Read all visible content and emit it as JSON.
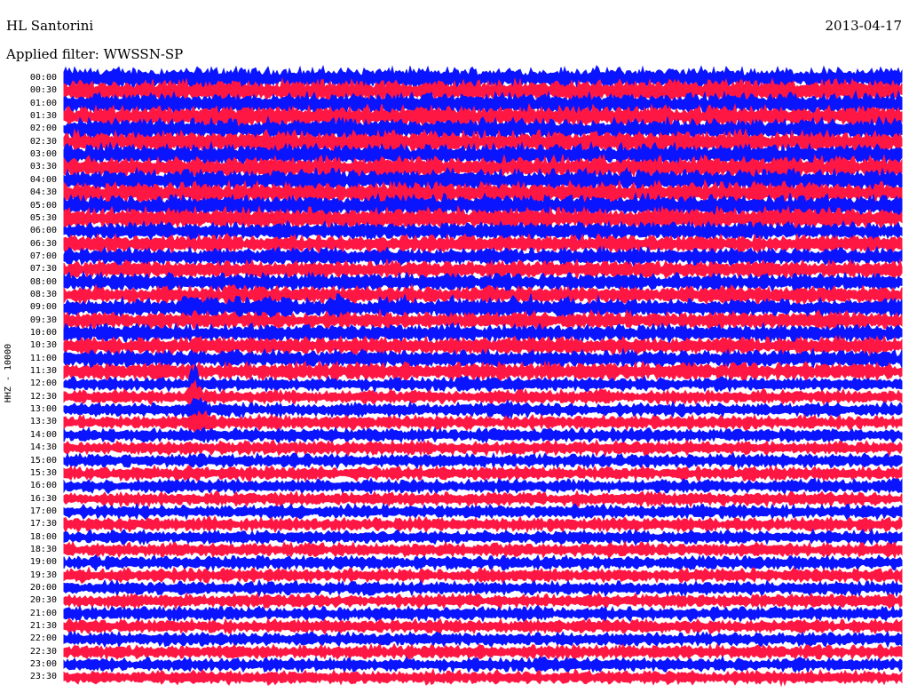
{
  "header": {
    "station": "HL Santorini",
    "date": "2013-04-17",
    "filter": "Applied filter: WWSSN-SP"
  },
  "channel_label": "HHZ - 10000",
  "colors": {
    "red": "#ff1744",
    "blue": "#0a14ff",
    "background": "#ffffff"
  },
  "chart_data": {
    "type": "line",
    "title": "HL Santorini",
    "subtitle": "Applied filter: WWSSN-SP",
    "date": "2013-04-17",
    "ylabel": "HHZ - 10000",
    "grid": false,
    "trace_colors_alternating": [
      "#0a14ff",
      "#ff1744"
    ],
    "rows": [
      {
        "time": "00:00"
      },
      {
        "time": "00:30"
      },
      {
        "time": "01:00"
      },
      {
        "time": "01:30"
      },
      {
        "time": "02:00"
      },
      {
        "time": "02:30"
      },
      {
        "time": "03:00"
      },
      {
        "time": "03:30"
      },
      {
        "time": "04:00"
      },
      {
        "time": "04:30"
      },
      {
        "time": "05:00"
      },
      {
        "time": "05:30"
      },
      {
        "time": "06:00"
      },
      {
        "time": "06:30"
      },
      {
        "time": "07:00"
      },
      {
        "time": "07:30"
      },
      {
        "time": "08:00"
      },
      {
        "time": "08:30"
      },
      {
        "time": "09:00"
      },
      {
        "time": "09:30"
      },
      {
        "time": "10:00"
      },
      {
        "time": "10:30"
      },
      {
        "time": "11:00"
      },
      {
        "time": "11:30"
      },
      {
        "time": "12:00"
      },
      {
        "time": "12:30"
      },
      {
        "time": "13:00"
      },
      {
        "time": "13:30"
      },
      {
        "time": "14:00"
      },
      {
        "time": "14:30"
      },
      {
        "time": "15:00"
      },
      {
        "time": "15:30"
      },
      {
        "time": "16:00"
      },
      {
        "time": "16:30"
      },
      {
        "time": "17:00"
      },
      {
        "time": "17:30"
      },
      {
        "time": "18:00"
      },
      {
        "time": "18:30"
      },
      {
        "time": "19:00"
      },
      {
        "time": "19:30"
      },
      {
        "time": "20:00"
      },
      {
        "time": "20:30"
      },
      {
        "time": "21:00"
      },
      {
        "time": "21:30"
      },
      {
        "time": "22:00"
      },
      {
        "time": "22:30"
      },
      {
        "time": "23:00"
      },
      {
        "time": "23:30"
      }
    ]
  }
}
